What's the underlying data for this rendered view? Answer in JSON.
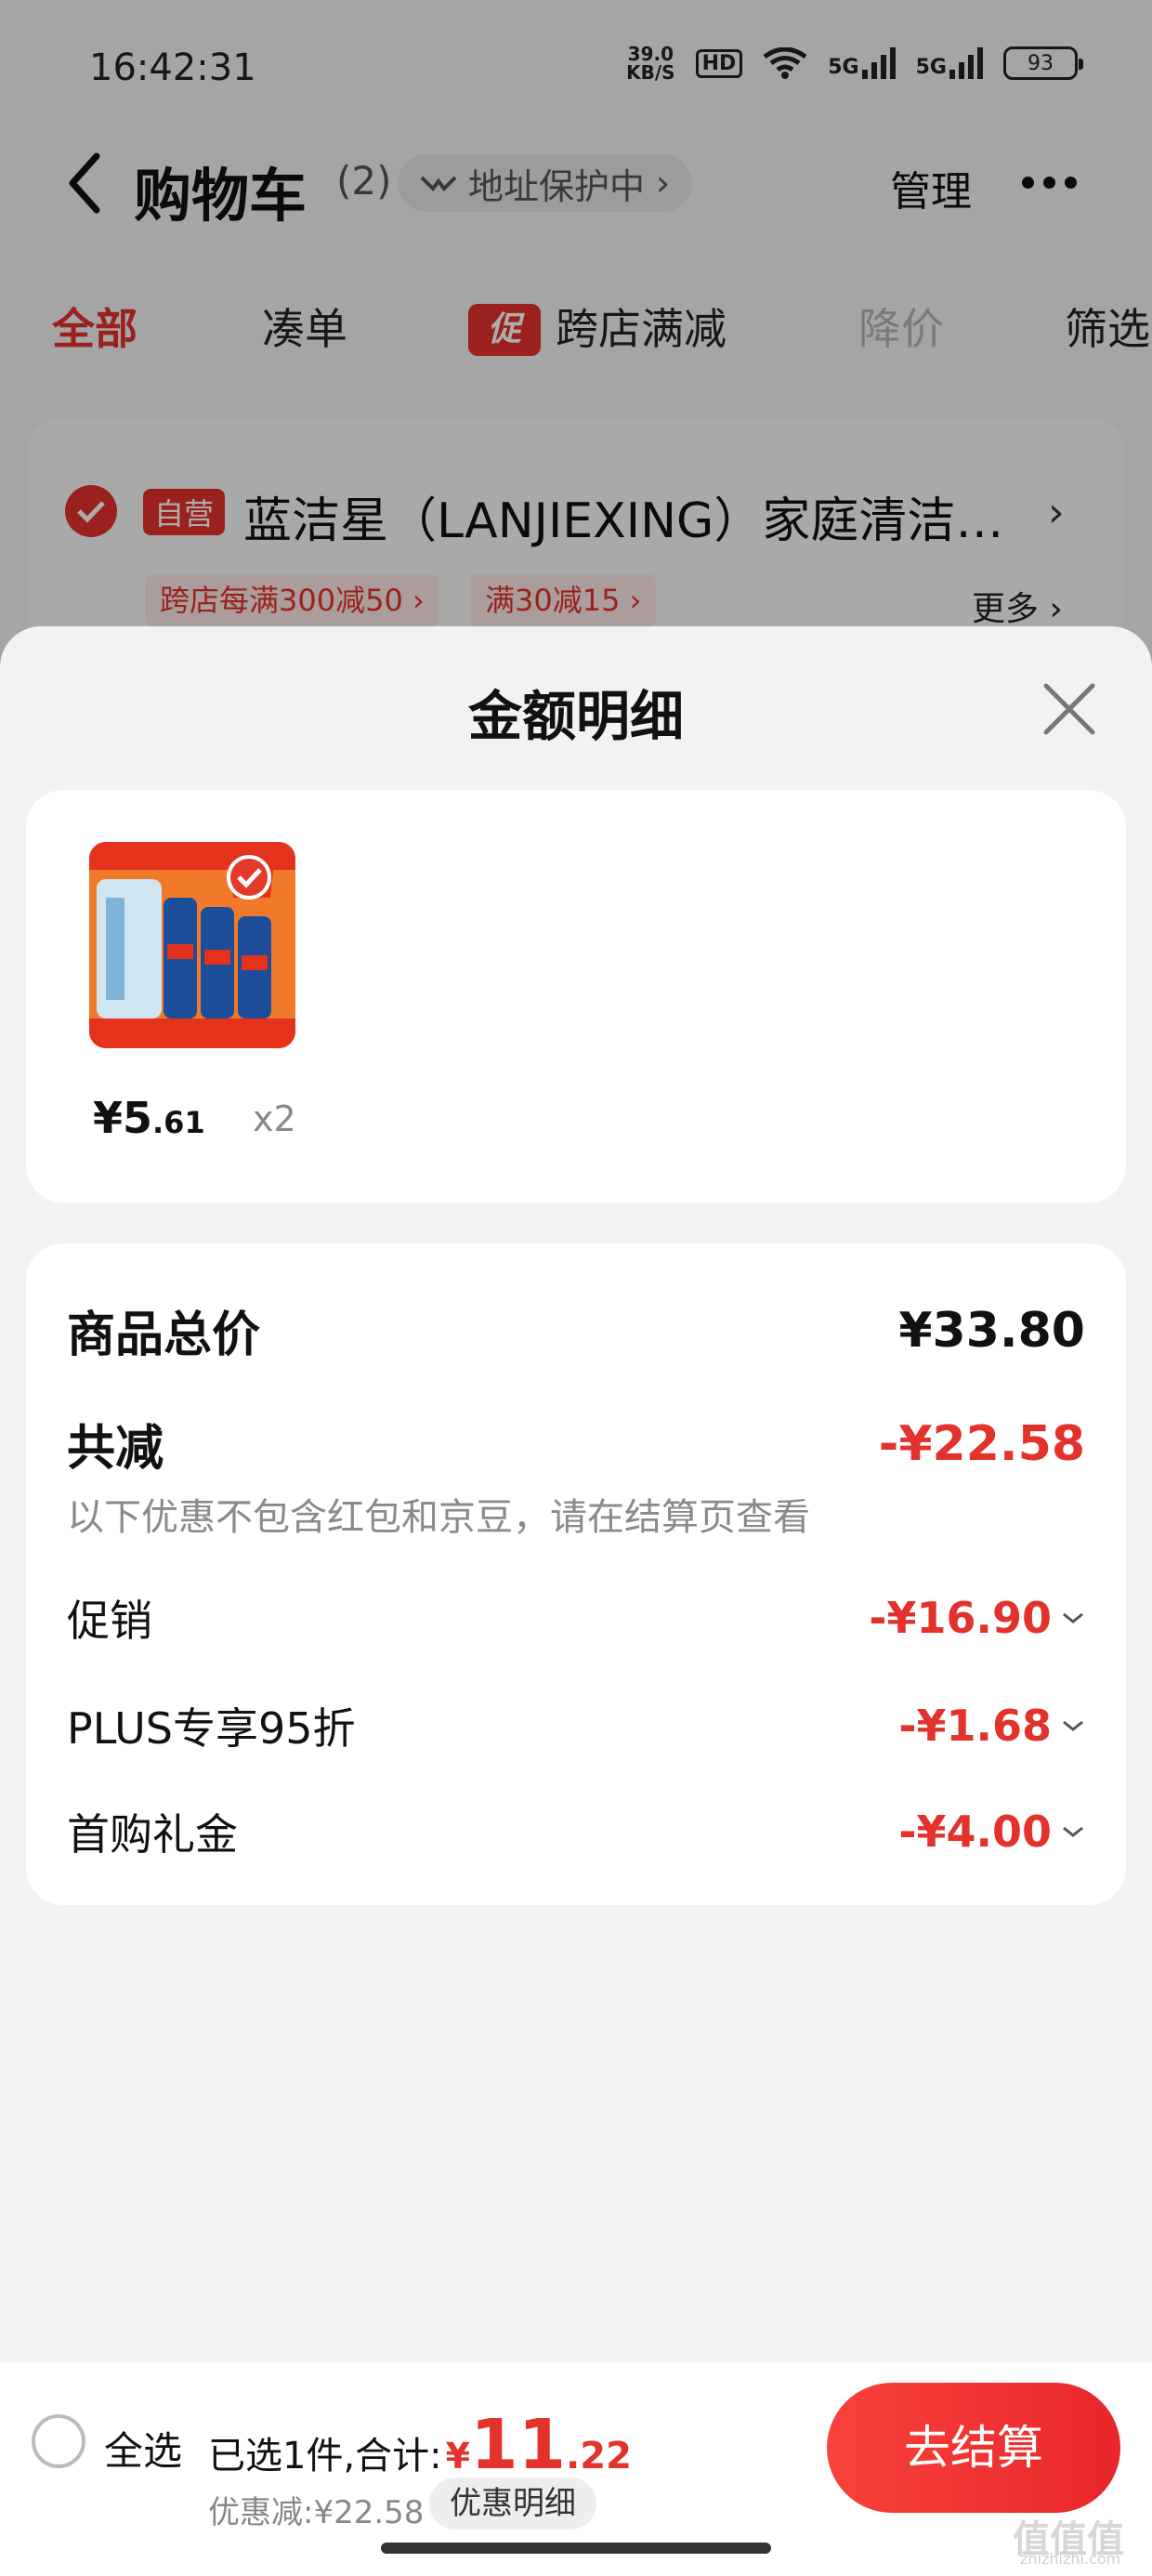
{
  "status_bar": {
    "time": "16:42:31",
    "speed_value": "39.0",
    "speed_unit": "KB/S",
    "hd": "HD",
    "net1": "5G",
    "net2": "5G",
    "battery": "93"
  },
  "header": {
    "title": "购物车",
    "count": "(2)",
    "address": "地址保护中",
    "manage": "管理"
  },
  "tabs": [
    {
      "label": "全部"
    },
    {
      "label": "凑单"
    },
    {
      "badge": "促",
      "label": "跨店满减"
    },
    {
      "label": "降价"
    },
    {
      "label": "筛选"
    }
  ],
  "shop": {
    "badge": "自营",
    "name": "蓝洁星（LANJIEXING）家庭清洁…",
    "coupons": [
      "跨店每满300减50 ›",
      "满30减15 ›"
    ],
    "more": "更多 ›"
  },
  "sheet": {
    "title": "金额明细",
    "product": {
      "price_main": "¥5",
      "price_dec": ".61",
      "qty": "x2",
      "image": "drain-cleaner-product-image"
    },
    "summary": {
      "total_label": "商品总价",
      "total_value": "¥33.80",
      "reduce_label": "共减",
      "reduce_value": "-¥22.58",
      "note": "以下优惠不包含红包和京豆，请在结算页查看",
      "items": [
        {
          "label": "促销",
          "value": "-¥16.90"
        },
        {
          "label": "PLUS专享95折",
          "value": "-¥1.68"
        },
        {
          "label": "首购礼金",
          "value": "-¥4.00"
        }
      ]
    }
  },
  "bottom": {
    "select_all": "全选",
    "selected_text": "已选1件,合计:",
    "yen": "¥",
    "total_main": "11",
    "total_dec": ".22",
    "saved": "优惠减:¥22.58",
    "detail_button": "优惠明细",
    "checkout": "去结算"
  },
  "watermark": {
    "logo": "值值值",
    "site": "zhizhizhi.com"
  },
  "colors": {
    "accent": "#e3312c",
    "checkout_start": "#f9423c",
    "checkout_end": "#e8262a"
  }
}
